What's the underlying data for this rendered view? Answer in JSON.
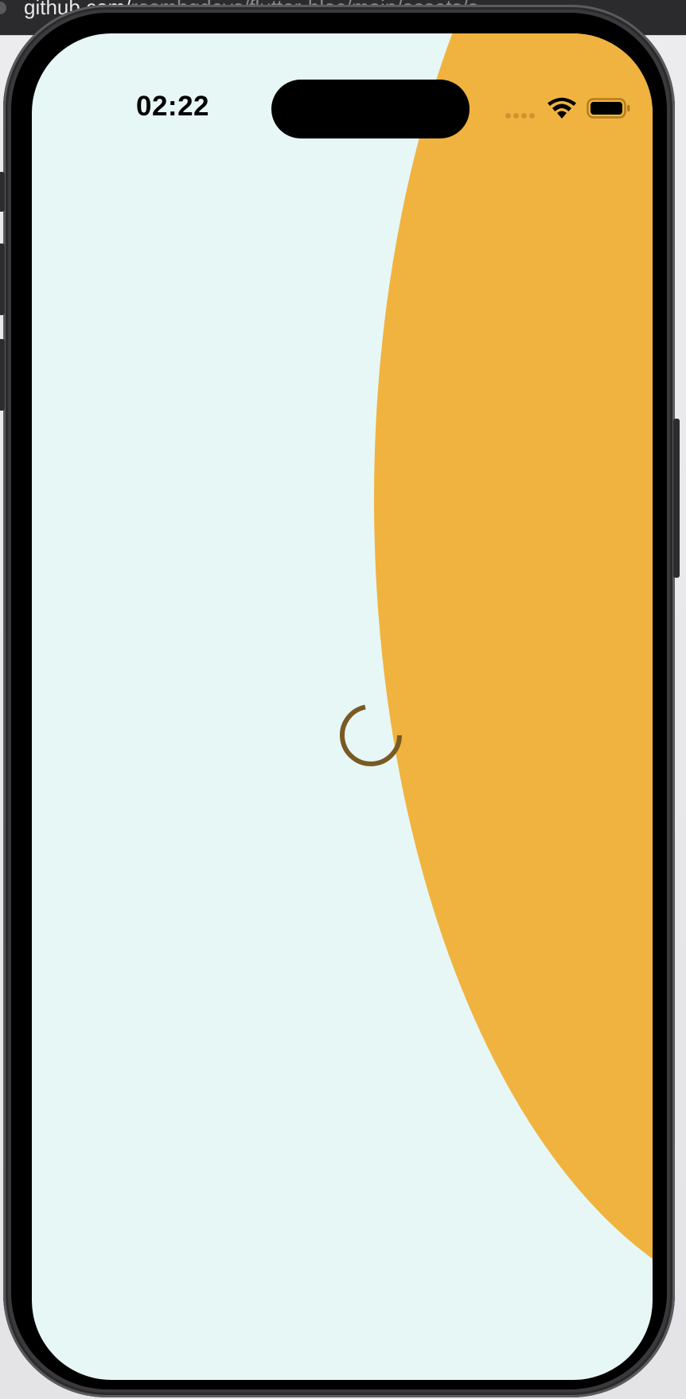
{
  "browser": {
    "url_prefix": "github.com/",
    "url_rest": "rosmbgdevs/flutter-bloc/main/assets/s"
  },
  "status_bar": {
    "time": "02:22",
    "wifi_icon": "wifi-icon",
    "battery_icon": "battery-icon",
    "signal_icon": "cellular-signal-icon"
  },
  "screen": {
    "state": "loading",
    "loading_icon": "loading-spinner-icon"
  },
  "colors": {
    "background": "#e6f7f6",
    "accent_shape": "#f1b33f",
    "spinner": "#7a5a22",
    "signal_dots": "#c8852b"
  }
}
